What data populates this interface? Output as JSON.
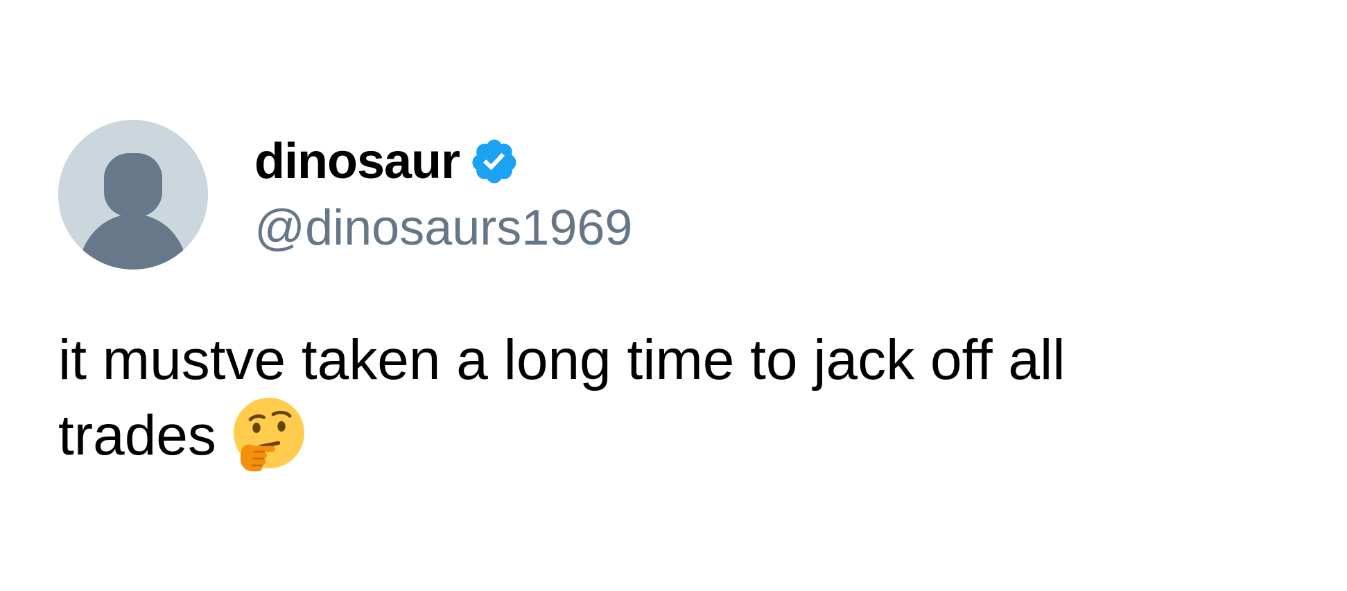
{
  "author": {
    "display_name": "dinosaur",
    "handle": "@dinosaurs1969",
    "verified": true,
    "avatar_icon": "default-profile-icon",
    "badge_icon": "verified-badge-icon"
  },
  "tweet": {
    "text_line_1": "it mustve taken a long time to jack off all",
    "text_line_2": "trades",
    "emoji_icon": "thinking-face-emoji"
  },
  "colors": {
    "avatar_background": "#ccd6dd",
    "avatar_silhouette": "#66788a",
    "verified_blue": "#1da1f2",
    "handle_gray": "#657786",
    "text_black": "#000000",
    "background": "#ffffff"
  }
}
